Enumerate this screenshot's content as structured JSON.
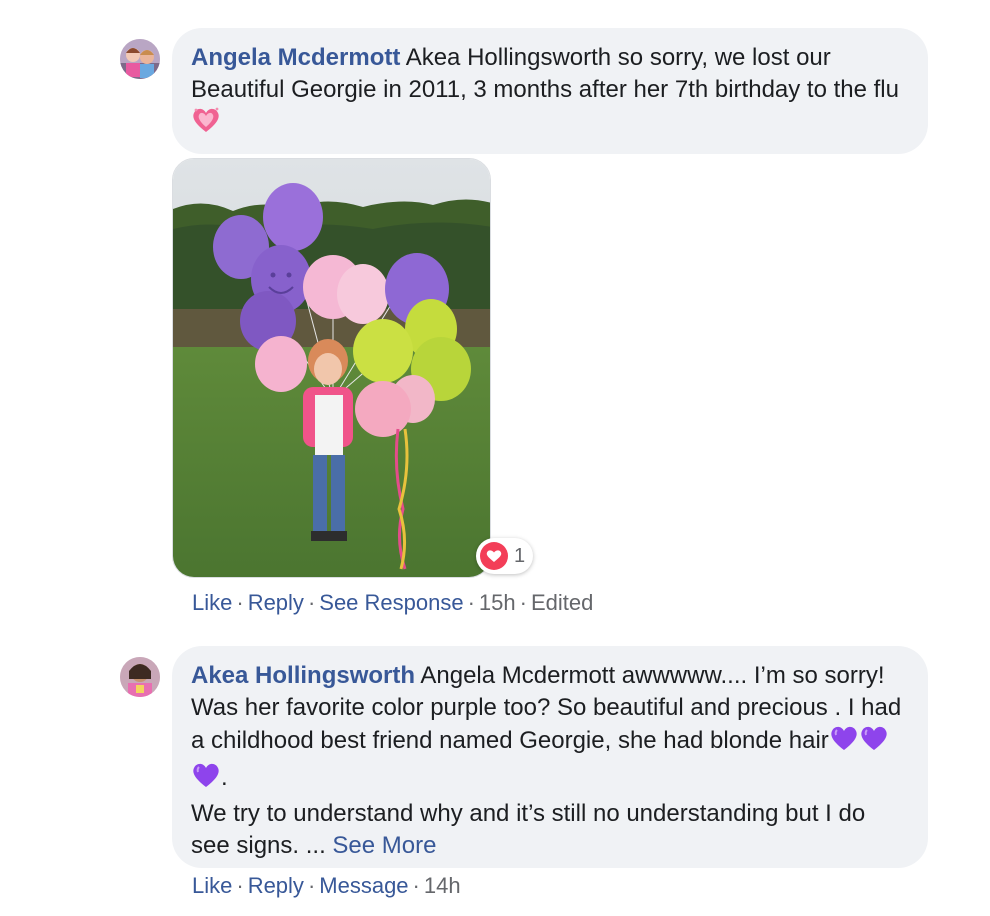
{
  "comments": [
    {
      "author": "Angela Mcdermott",
      "text": "Akea Hollingsworth so sorry, we lost our Beautiful Georgie in 2011, 3 months after her 7th birthday to the flu",
      "emoji": "sparkling-heart-icon",
      "has_photo": true,
      "reaction": {
        "type": "heart-icon",
        "count": "1",
        "color": "#f33e58"
      },
      "actions": {
        "like": "Like",
        "reply": "Reply",
        "response": "See Response",
        "time": "15h",
        "edited": "Edited"
      }
    },
    {
      "author": "Akea Hollingsworth",
      "text_line1": "Angela Mcdermott awwwww.... I’m so sorry! Was her favorite color purple too? So beautiful and precious . I had a childhood best friend named Georgie, she had blonde hair",
      "emoji_count": 3,
      "emoji": "purple-heart-icon",
      "text_after_emoji": ".",
      "text_line2": "We try to understand why and it’s still no understanding but I do see signs. ...",
      "see_more": "See More",
      "actions": {
        "like": "Like",
        "reply": "Reply",
        "message": "Message",
        "time": "14h"
      }
    }
  ],
  "colors": {
    "link": "#385898",
    "bubble": "#f0f2f5",
    "meta": "#65676b",
    "purple_heart": "#8e44ec"
  }
}
